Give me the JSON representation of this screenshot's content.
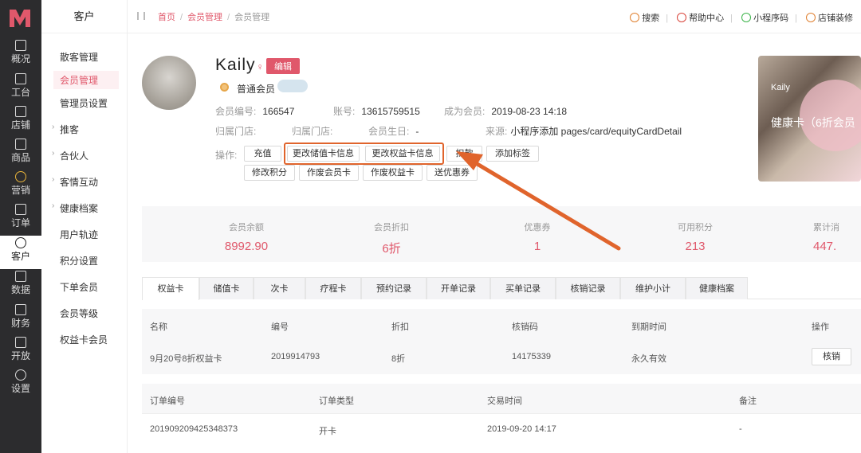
{
  "rail": {
    "items": [
      {
        "label": "概况",
        "icon": "chart-icon"
      },
      {
        "label": "工台",
        "icon": "monitor-icon"
      },
      {
        "label": "店铺",
        "icon": "store-icon"
      },
      {
        "label": "商品",
        "icon": "bag-icon"
      },
      {
        "label": "营销",
        "icon": "flower-icon"
      },
      {
        "label": "订单",
        "icon": "order-icon"
      },
      {
        "label": "客户",
        "icon": "user-icon"
      },
      {
        "label": "数据",
        "icon": "data-icon"
      },
      {
        "label": "财务",
        "icon": "finance-icon"
      },
      {
        "label": "开放",
        "icon": "code-icon"
      },
      {
        "label": "设置",
        "icon": "gear-icon"
      }
    ]
  },
  "submenu": {
    "title": "客户",
    "items": [
      {
        "label": "散客管理",
        "arrow": ""
      },
      {
        "label": "会员管理",
        "arrow": ""
      },
      {
        "label": "管理员设置",
        "arrow": ""
      },
      {
        "label": "推客",
        "arrow": "›"
      },
      {
        "label": "合伙人",
        "arrow": "›"
      },
      {
        "label": "客情互动",
        "arrow": "›"
      },
      {
        "label": "健康档案",
        "arrow": "›"
      },
      {
        "label": "用户轨迹",
        "arrow": ""
      },
      {
        "label": "积分设置",
        "arrow": ""
      },
      {
        "label": "下单会员",
        "arrow": ""
      },
      {
        "label": "会员等级",
        "arrow": ""
      },
      {
        "label": "权益卡会员",
        "arrow": ""
      }
    ]
  },
  "breadcrumb": {
    "home": "首页",
    "parent": "会员管理",
    "current": "会员管理",
    "sep": "/"
  },
  "top_actions": {
    "search": "搜索",
    "help": "帮助中心",
    "miniprogram": "小程序码",
    "decorate": "店铺装修"
  },
  "member": {
    "name": "Kaily",
    "gender_symbol": "♀",
    "edit_label": "编辑",
    "level": "普通会员",
    "no_label": "会员编号:",
    "no": "166547",
    "account_label": "账号:",
    "account": "13615759515",
    "joined_label": "成为会员:",
    "joined": "2019-08-23 14:18",
    "store_label": "归属门店:",
    "store": "",
    "store2_label": "归属门店:",
    "store2": "",
    "birthday_label": "会员生日:",
    "birthday": "-",
    "source_label": "来源:",
    "source": "小程序添加 pages/card/equityCardDetail"
  },
  "ops": {
    "label": "操作:",
    "buttons": [
      "充值",
      "更改储值卡信息",
      "更改权益卡信息",
      "扣款",
      "添加标签",
      "修改积分",
      "作废会员卡",
      "作废权益卡",
      "送优惠券"
    ]
  },
  "banner": {
    "name": "Kaily",
    "title": "健康卡（6折会员"
  },
  "stats": [
    {
      "label": "会员余额",
      "value": "8992.90"
    },
    {
      "label": "会员折扣",
      "value": "6折"
    },
    {
      "label": "优惠券",
      "value": "1"
    },
    {
      "label": "可用积分",
      "value": "213"
    },
    {
      "label": "累计消",
      "value": "447."
    }
  ],
  "tabs": [
    "权益卡",
    "储值卡",
    "次卡",
    "疗程卡",
    "预约记录",
    "开单记录",
    "买单记录",
    "核销记录",
    "维护小计",
    "健康档案"
  ],
  "card_table": {
    "headers": [
      "名称",
      "编号",
      "折扣",
      "核销码",
      "到期时间",
      "操作"
    ],
    "row": [
      "9月20号8折权益卡",
      "2019914793",
      "8折",
      "14175339",
      "永久有效"
    ],
    "action": "核销"
  },
  "order_table": {
    "headers": [
      "订单编号",
      "订单类型",
      "交易时间",
      "备注"
    ],
    "row": [
      "201909209425348373",
      "开卡",
      "2019-09-20 14:17",
      "-"
    ]
  },
  "colors": {
    "accent": "#e0586b",
    "highlight": "#e0642c",
    "rail": "#2c2c2e"
  }
}
